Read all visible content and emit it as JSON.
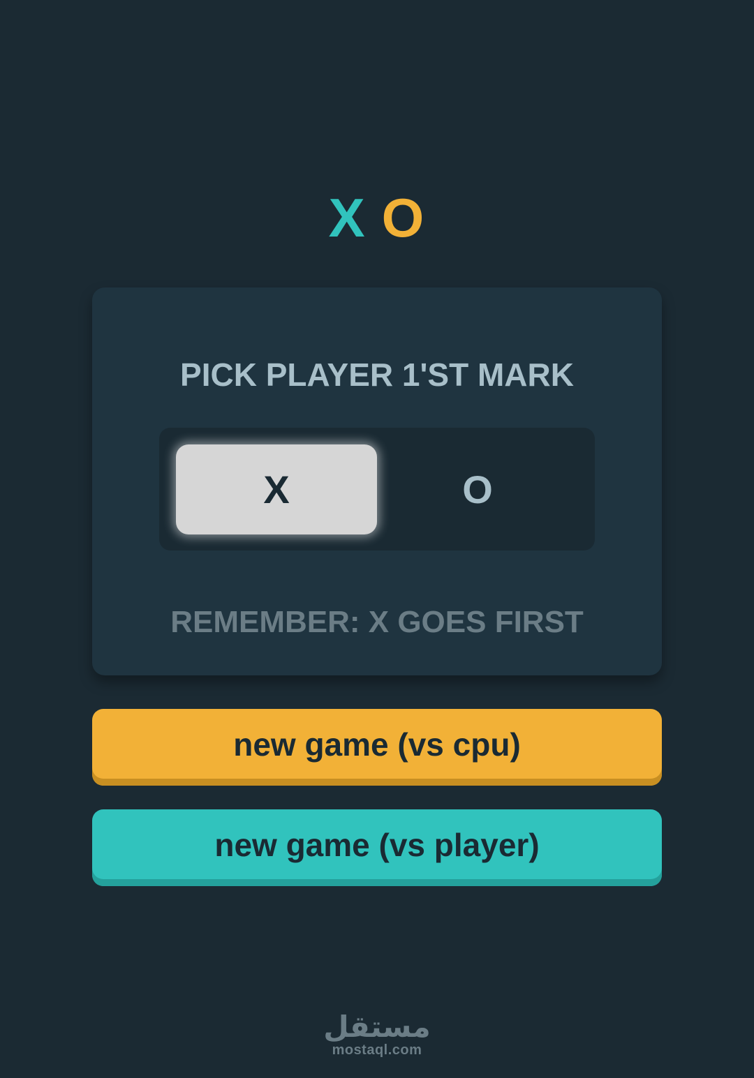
{
  "logo": {
    "x": "X",
    "o": "O"
  },
  "card": {
    "title": "PICK PLAYER 1'ST MARK",
    "options": {
      "x": "X",
      "o": "O"
    },
    "selected": "X",
    "note": "REMEMBER: X GOES FIRST"
  },
  "buttons": {
    "cpu": "new game (vs cpu)",
    "player": "new game (vs player)"
  },
  "watermark": {
    "arabic": "مستقل",
    "latin": "mostaql.com"
  },
  "colors": {
    "background": "#1b2a33",
    "card": "#1f3440",
    "teal": "#31c3bd",
    "yellow": "#f2b137",
    "silver": "#a8bfc9"
  }
}
